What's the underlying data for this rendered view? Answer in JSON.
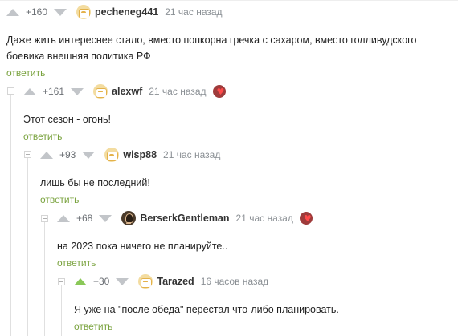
{
  "comments": [
    {
      "rating": "+160",
      "username": "pecheneg441",
      "time": "21 час назад",
      "text_lines": [
        "Даже жить интереснее стало, вместо попкорна гречка с сахаром, вместо голливудского",
        "боевика внешняя политика РФ"
      ],
      "reply": "ответить"
    },
    {
      "rating": "+161",
      "username": "alexwf",
      "time": "21 час назад",
      "text_lines": [
        "Этот сезон - огонь!"
      ],
      "reply": "ответить"
    },
    {
      "rating": "+93",
      "username": "wisp88",
      "time": "21 час назад",
      "text_lines": [
        "лишь бы не последний!"
      ],
      "reply": "ответить"
    },
    {
      "rating": "+68",
      "username": "BerserkGentleman",
      "time": "21 час назад",
      "text_lines": [
        "на 2023 пока ничего не планируйте.."
      ],
      "reply": "ответить"
    },
    {
      "rating": "+30",
      "username": "Tarazed",
      "time": "16 часов назад",
      "text_lines": [
        "Я уже на \"после обеда\" перестал что-либо планировать."
      ],
      "reply": "ответить"
    }
  ],
  "colors": {
    "accent": "#7aa33f",
    "upvote_active": "#8ac858",
    "arrow": "#c2c5c9"
  },
  "icons": {
    "up": "upvote-arrow-icon",
    "down": "downvote-arrow-icon",
    "collapse": "collapse-toggle-icon",
    "badge": "award-badge-icon"
  }
}
